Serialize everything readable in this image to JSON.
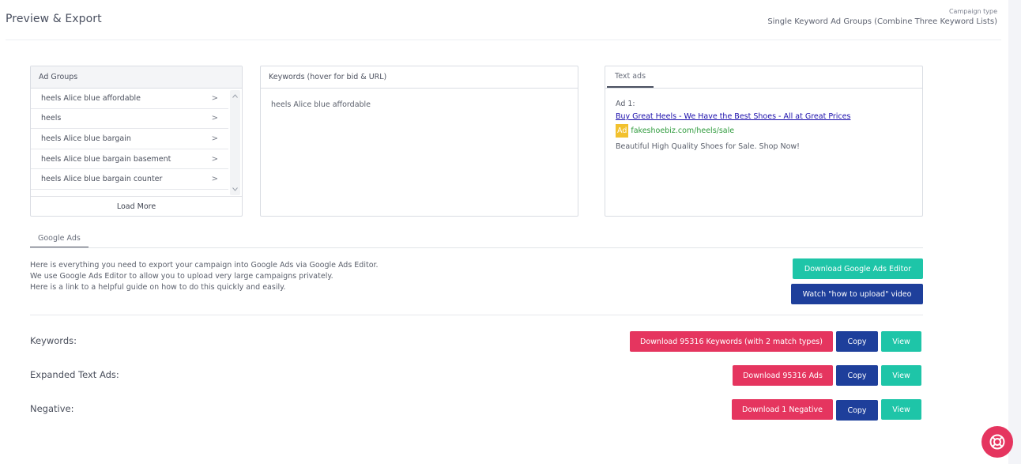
{
  "header": {
    "title": "Preview & Export",
    "campaign_type_label": "Campaign type",
    "campaign_type_value": "Single Keyword Ad Groups (Combine Three Keyword Lists)"
  },
  "ad_groups": {
    "title": "Ad Groups",
    "items": [
      {
        "label": "heels Alice blue affordable"
      },
      {
        "label": "heels"
      },
      {
        "label": "heels Alice blue bargain"
      },
      {
        "label": "heels Alice blue bargain basement"
      },
      {
        "label": "heels Alice blue bargain counter"
      }
    ],
    "chevron": ">",
    "load_more": "Load More"
  },
  "keywords_panel": {
    "title": "Keywords (hover for bid & URL)",
    "items": [
      "heels Alice blue affordable"
    ]
  },
  "text_ads": {
    "tab": "Text ads",
    "ad_label": "Ad 1:",
    "headline": "Buy Great Heels - We Have the Best Shoes - All at Great Prices",
    "badge": "Ad",
    "display_url": "fakeshoebiz.com/heels/sale",
    "description": "Beautiful High Quality Shoes for Sale. Shop Now!",
    "badge_color": "#f2c12e",
    "url_color": "#2e9a3c",
    "headline_color": "#1a0dab"
  },
  "google_ads": {
    "tab": "Google Ads",
    "description_lines": [
      "Here is everything you need to export your campaign into Google Ads via Google Ads Editor.",
      "We use Google Ads Editor to allow you to upload very large campaigns privately.",
      "Here is a link to a helpful guide on how to do this quickly and easily."
    ],
    "download_editor": "Download Google Ads Editor",
    "watch_video": "Watch \"how to upload\" video"
  },
  "exports": {
    "keywords": {
      "label": "Keywords:",
      "download": "Download 95316 Keywords (with 2 match types)",
      "copy": "Copy",
      "view": "View"
    },
    "ads": {
      "label": "Expanded Text Ads:",
      "download": "Download 95316 Ads",
      "copy": "Copy",
      "view": "View"
    },
    "negative": {
      "label": "Negative:",
      "download": "Download 1 Negative",
      "copy": "Copy",
      "view": "View"
    }
  },
  "colors": {
    "teal": "#1ec5a8",
    "navy": "#1e3f9b",
    "red": "#e5355f"
  },
  "icons": {
    "help": "lifebuoy-icon",
    "chevron": "chevron-right-icon"
  }
}
